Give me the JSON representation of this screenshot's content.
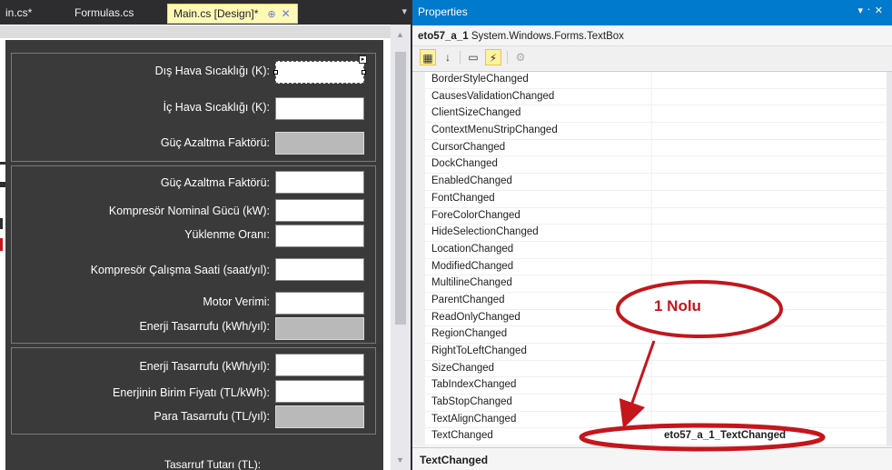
{
  "tabs": [
    {
      "label": "in.cs*"
    },
    {
      "label": "Formulas.cs"
    },
    {
      "label": "Main.cs [Design]*",
      "pin": "⊕",
      "close": "✕"
    }
  ],
  "form": {
    "group1": [
      {
        "label": "Dış Hava Sıcaklığı (K):"
      },
      {
        "label": "İç Hava Sıcaklığı (K):"
      },
      {
        "label": "Güç Azaltma Faktörü:"
      }
    ],
    "group2": [
      {
        "label": "Güç Azaltma Faktörü:"
      },
      {
        "label": "Kompresör Nominal Gücü (kW):"
      },
      {
        "label": "Yüklenme Oranı:"
      },
      {
        "label": "Kompresör Çalışma Saati (saat/yıl):"
      },
      {
        "label": "Motor Verimi:"
      },
      {
        "label": "Enerji Tasarrufu (kWh/yıl):"
      }
    ],
    "group3": [
      {
        "label": "Enerji Tasarrufu (kWh/yıl):"
      },
      {
        "label": "Enerjinin Birim Fiyatı (TL/kWh):"
      },
      {
        "label": "Para Tasarrufu (TL/yıl):"
      }
    ],
    "bottom_label": "Tasarruf Tutarı (TL):"
  },
  "properties": {
    "title": "Properties",
    "pin_controls": "▾ ᛫ ✕",
    "object_name": "eto57_a_1",
    "object_type": "System.Windows.Forms.TextBox",
    "events": [
      {
        "name": "BorderStyleChanged",
        "value": ""
      },
      {
        "name": "CausesValidationChanged",
        "value": ""
      },
      {
        "name": "ClientSizeChanged",
        "value": ""
      },
      {
        "name": "ContextMenuStripChanged",
        "value": ""
      },
      {
        "name": "CursorChanged",
        "value": ""
      },
      {
        "name": "DockChanged",
        "value": ""
      },
      {
        "name": "EnabledChanged",
        "value": ""
      },
      {
        "name": "FontChanged",
        "value": ""
      },
      {
        "name": "ForeColorChanged",
        "value": ""
      },
      {
        "name": "HideSelectionChanged",
        "value": ""
      },
      {
        "name": "LocationChanged",
        "value": ""
      },
      {
        "name": "ModifiedChanged",
        "value": ""
      },
      {
        "name": "MultilineChanged",
        "value": ""
      },
      {
        "name": "ParentChanged",
        "value": ""
      },
      {
        "name": "ReadOnlyChanged",
        "value": ""
      },
      {
        "name": "RegionChanged",
        "value": ""
      },
      {
        "name": "RightToLeftChanged",
        "value": ""
      },
      {
        "name": "SizeChanged",
        "value": ""
      },
      {
        "name": "TabIndexChanged",
        "value": ""
      },
      {
        "name": "TabStopChanged",
        "value": ""
      },
      {
        "name": "TextAlignChanged",
        "value": ""
      },
      {
        "name": "TextChanged",
        "value": "eto57_a_1_TextChanged"
      }
    ],
    "description": "TextChanged"
  },
  "annotation": {
    "text": "1 Nolu",
    "color": "#c4161c"
  },
  "colors": {
    "accent": "#007acc",
    "active_tab": "#fff9b8",
    "form_bg": "#3a3a3a",
    "annotation": "#c4161c"
  }
}
